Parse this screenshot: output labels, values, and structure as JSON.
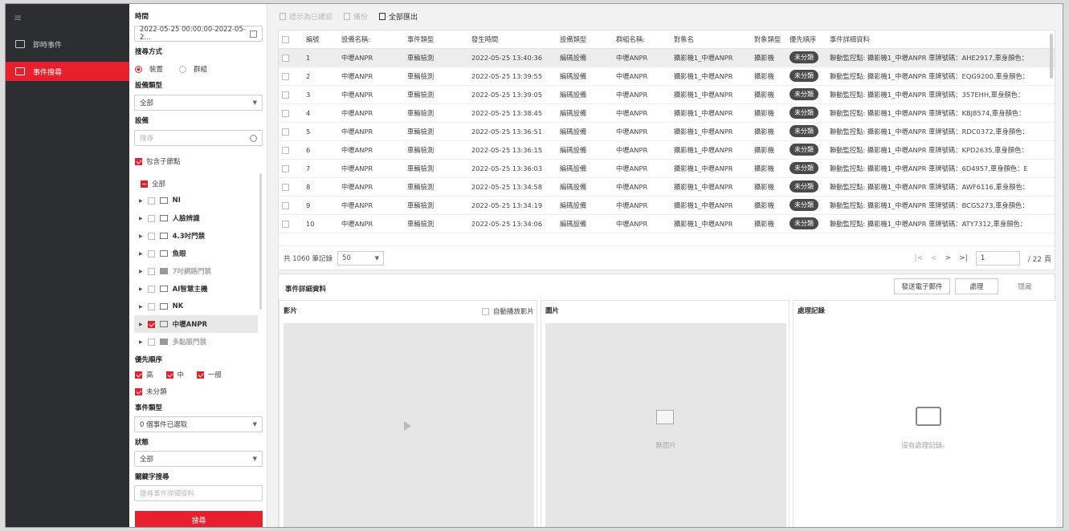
{
  "nav": {
    "items": [
      {
        "label": "即時事件",
        "active": false,
        "icon": "bell-icon"
      },
      {
        "label": "事件搜尋",
        "active": true,
        "icon": "search-list-icon"
      }
    ]
  },
  "filter": {
    "time_label": "時間",
    "time_value": "2022-05-25 00:00:00-2022-05-2...",
    "search_mode_label": "搜尋方式",
    "mode_device": "裝置",
    "mode_group": "群組",
    "device_type_label": "設備類型",
    "device_type_value": "全部",
    "device_label": "設備",
    "device_search_placeholder": "搜尋",
    "include_child": "包含子節點",
    "tree_root": "全部",
    "tree": [
      {
        "label": "NI",
        "checked": false,
        "dim": false
      },
      {
        "label": "人臉辨識",
        "checked": false,
        "dim": false
      },
      {
        "label": "4.3吋門禁",
        "checked": false,
        "dim": false
      },
      {
        "label": "魚眼",
        "checked": false,
        "dim": false
      },
      {
        "label": "7吋網路門禁",
        "checked": false,
        "dim": true
      },
      {
        "label": "AI智慧主機",
        "checked": false,
        "dim": false
      },
      {
        "label": "NK",
        "checked": false,
        "dim": false
      },
      {
        "label": "中壢ANPR",
        "checked": true,
        "dim": false
      },
      {
        "label": "多點臉門禁",
        "checked": false,
        "dim": true
      }
    ],
    "priority_label": "優先順序",
    "priority_high": "高",
    "priority_mid": "中",
    "priority_normal": "一般",
    "uncategorized": "未分類",
    "event_type_label": "事件類型",
    "event_type_value": "0 個事件已選取",
    "status_label": "狀態",
    "status_value": "全部",
    "keyword_label": "關鍵字搜尋",
    "keyword_placeholder": "搜尋事件詳細資料",
    "search_button": "搜尋"
  },
  "toolbar": {
    "btn1": "標示為已確認",
    "btn2": "備份",
    "btn3": "全部匯出"
  },
  "table": {
    "headers": [
      "編號",
      "設備名稱:",
      "事件類型",
      "發生時間",
      "設備類型",
      "群組名稱:",
      "對象名",
      "對象類型",
      "優先順序",
      "事件詳細資料"
    ],
    "rows": [
      [
        "1",
        "中壢ANPR",
        "車輛檢測",
        "2022-05-25 13:40:36",
        "編碼設備",
        "中壢ANPR",
        "攝影機1_中壢ANPR",
        "攝影機",
        "未分類",
        "聯動監控點: 攝影機1_中壢ANPR 車牌號碼：AHE2917,車身顏色："
      ],
      [
        "2",
        "中壢ANPR",
        "車輛檢測",
        "2022-05-25 13:39:55",
        "編碼設備",
        "中壢ANPR",
        "攝影機1_中壢ANPR",
        "攝影機",
        "未分類",
        "聯動監控點: 攝影機1_中壢ANPR 車牌號碼：EQG9200,車身顏色："
      ],
      [
        "3",
        "中壢ANPR",
        "車輛檢測",
        "2022-05-25 13:39:05",
        "編碼設備",
        "中壢ANPR",
        "攝影機1_中壢ANPR",
        "攝影機",
        "未分類",
        "聯動監控點: 攝影機1_中壢ANPR 車牌號碼：357EHH,車身顏色："
      ],
      [
        "4",
        "中壢ANPR",
        "車輛檢測",
        "2022-05-25 13:38:45",
        "編碼設備",
        "中壢ANPR",
        "攝影機1_中壢ANPR",
        "攝影機",
        "未分類",
        "聯動監控點: 攝影機1_中壢ANPR 車牌號碼：KBJ8574,車身顏色："
      ],
      [
        "5",
        "中壢ANPR",
        "車輛檢測",
        "2022-05-25 13:36:51",
        "編碼設備",
        "中壢ANPR",
        "攝影機1_中壢ANPR",
        "攝影機",
        "未分類",
        "聯動監控點: 攝影機1_中壢ANPR 車牌號碼：RDC0372,車身顏色："
      ],
      [
        "6",
        "中壢ANPR",
        "車輛檢測",
        "2022-05-25 13:36:15",
        "編碼設備",
        "中壢ANPR",
        "攝影機1_中壢ANPR",
        "攝影機",
        "未分類",
        "聯動監控點: 攝影機1_中壢ANPR 車牌號碼：KPD2635,車身顏色："
      ],
      [
        "7",
        "中壢ANPR",
        "車輛檢測",
        "2022-05-25 13:36:03",
        "編碼設備",
        "中壢ANPR",
        "攝影機1_中壢ANPR",
        "攝影機",
        "未分類",
        "聯動監控點: 攝影機1_中壢ANPR 車牌號碼：6D4957,車身顏色：E"
      ],
      [
        "8",
        "中壢ANPR",
        "車輛檢測",
        "2022-05-25 13:34:58",
        "編碼設備",
        "中壢ANPR",
        "攝影機1_中壢ANPR",
        "攝影機",
        "未分類",
        "聯動監控點: 攝影機1_中壢ANPR 車牌號碼：AWF6116,車身顏色："
      ],
      [
        "9",
        "中壢ANPR",
        "車輛檢測",
        "2022-05-25 13:34:19",
        "編碼設備",
        "中壢ANPR",
        "攝影機1_中壢ANPR",
        "攝影機",
        "未分類",
        "聯動監控點: 攝影機1_中壢ANPR 車牌號碼：BCG5273,車身顏色："
      ],
      [
        "10",
        "中壢ANPR",
        "車輛檢測",
        "2022-05-25 13:34:06",
        "編碼設備",
        "中壢ANPR",
        "攝影機1_中壢ANPR",
        "攝影機",
        "未分類",
        "聯動監控點: 攝影機1_中壢ANPR 車牌號碼：ATY7312,車身顏色："
      ]
    ]
  },
  "pager": {
    "total": "共 1060 筆記錄",
    "page_size": "50",
    "page": "1",
    "total_pages": "/ 22 頁"
  },
  "detail": {
    "title": "事件詳細資料",
    "btn_email": "發送電子郵件",
    "btn_handle": "處理",
    "btn_hide": "隱藏",
    "video_label": "影片",
    "autoplay": "自動播放影片",
    "image_label": "圖片",
    "no_image": "無圖片",
    "record_label": "處理記錄",
    "no_record": "沒有處理記錄。"
  },
  "colors": {
    "accent": "#e81f2d",
    "nav_bg": "#2d2e32"
  }
}
